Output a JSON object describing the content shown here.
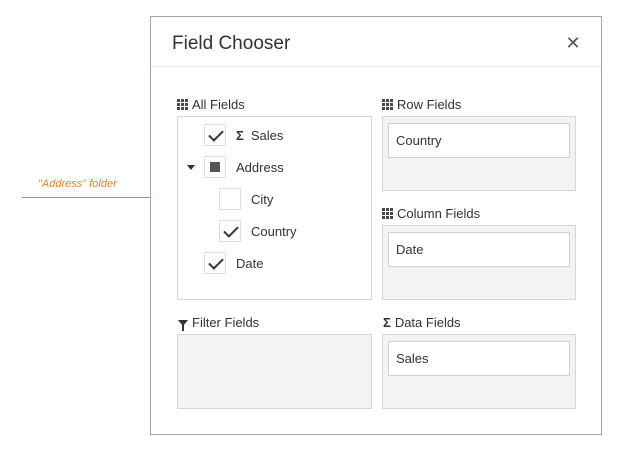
{
  "annotation": {
    "label": "\"Address\" folder"
  },
  "dialog": {
    "title": "Field Chooser",
    "close_icon": "✕"
  },
  "all_fields": {
    "header": "All Fields",
    "icon": "grid-icon",
    "items": [
      {
        "label": "Sales",
        "checked": true,
        "icon": "sigma-icon",
        "icon_glyph": "Σ"
      },
      {
        "label": "Address",
        "state": "indeterminate",
        "expanded": true
      },
      {
        "label": "City",
        "checked": false
      },
      {
        "label": "Country",
        "checked": true
      },
      {
        "label": "Date",
        "checked": true
      }
    ]
  },
  "row_fields": {
    "header": "Row Fields",
    "icon": "grid-icon",
    "items": [
      "Country"
    ]
  },
  "column_fields": {
    "header": "Column Fields",
    "icon": "grid-icon",
    "items": [
      "Date"
    ]
  },
  "filter_fields": {
    "header": "Filter Fields",
    "icon": "filter-icon",
    "items": []
  },
  "data_fields": {
    "header": "Data Fields",
    "icon": "sigma-icon",
    "icon_glyph": "Σ",
    "items": [
      "Sales"
    ]
  },
  "colors": {
    "accent": "#e8822a",
    "area_bg": "#f3f3f3",
    "border": "#d6d6d6"
  }
}
